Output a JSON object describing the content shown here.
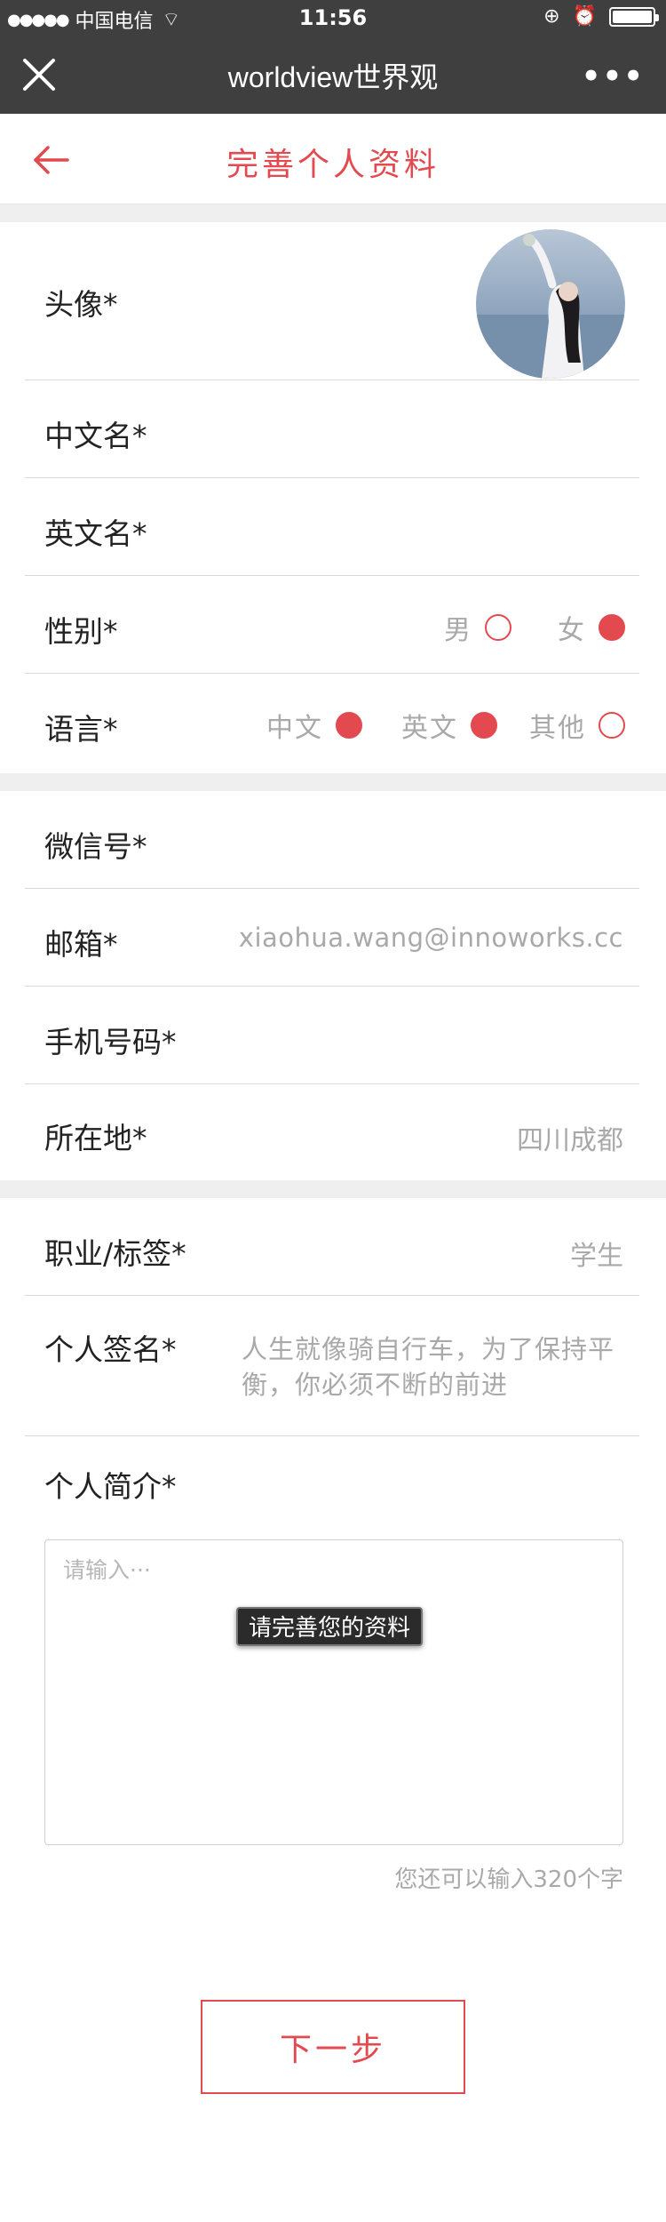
{
  "status_bar": {
    "signal": "●●●●●",
    "carrier": "中国电信",
    "wifi": "⌔",
    "time": "11:56",
    "lock": "⊕",
    "alarm": "⏰"
  },
  "nav": {
    "title": "worldview世界观",
    "more": "•••"
  },
  "page": {
    "title": "完善个人资料"
  },
  "avatar_row": {
    "label": "头像*"
  },
  "chinese_name": {
    "label": "中文名*",
    "value": ""
  },
  "english_name": {
    "label": "英文名*",
    "value": ""
  },
  "gender": {
    "label": "性别*",
    "options": [
      {
        "label": "男",
        "selected": false
      },
      {
        "label": "女",
        "selected": true
      }
    ]
  },
  "language": {
    "label": "语言*",
    "options": [
      {
        "label": "中文",
        "selected": true
      },
      {
        "label": "英文",
        "selected": true
      },
      {
        "label": "其他",
        "selected": false
      }
    ]
  },
  "wechat": {
    "label": "微信号*",
    "value": ""
  },
  "email": {
    "label": "邮箱*",
    "value": "xiaohua.wang@innoworks.cc"
  },
  "phone": {
    "label": "手机号码*",
    "value": ""
  },
  "location": {
    "label": "所在地*",
    "value": "四川成都"
  },
  "occupation": {
    "label": "职业/标签*",
    "value": "学生"
  },
  "signature": {
    "label": "个人签名*",
    "value": "人生就像骑自行车，为了保持平衡，你必须不断的前进"
  },
  "bio": {
    "label": "个人简介*",
    "placeholder": "请输入···",
    "counter": "您还可以输入320个字"
  },
  "toast": {
    "text": "请完善您的资料"
  },
  "next_button": {
    "label": "下一步"
  },
  "colors": {
    "accent": "#e24a4f",
    "topbar": "#3f3f3f",
    "placeholder": "#a9a9a9"
  }
}
